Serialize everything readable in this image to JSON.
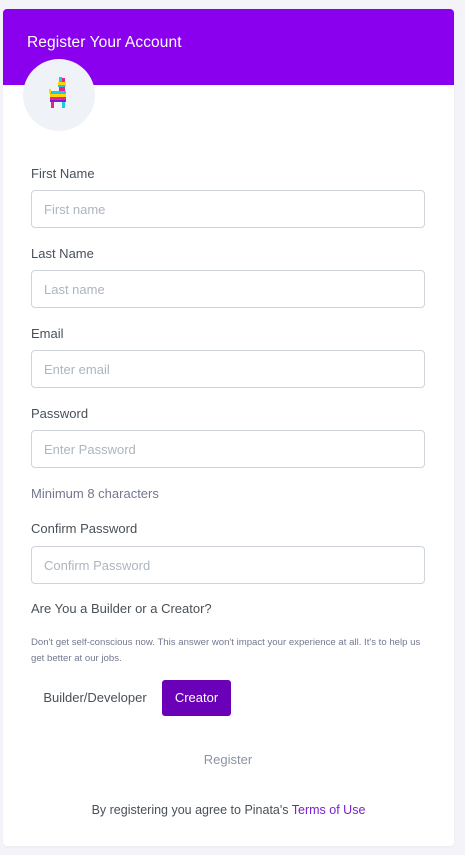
{
  "header": {
    "title": "Register Your Account"
  },
  "form": {
    "first_name": {
      "label": "First Name",
      "placeholder": "First name",
      "value": ""
    },
    "last_name": {
      "label": "Last Name",
      "placeholder": "Last name",
      "value": ""
    },
    "email": {
      "label": "Email",
      "placeholder": "Enter email",
      "value": ""
    },
    "password": {
      "label": "Password",
      "placeholder": "Enter Password",
      "value": "",
      "hint": "Minimum 8 characters"
    },
    "confirm_password": {
      "label": "Confirm Password",
      "placeholder": "Confirm Password",
      "value": ""
    },
    "role": {
      "question": "Are You a Builder or a Creator?",
      "note": "Don't get self-conscious now. This answer won't impact your experience at all. It's to help us get better at our jobs.",
      "options": [
        "Builder/Developer",
        "Creator"
      ],
      "selected": "Creator"
    },
    "register_label": "Register"
  },
  "footer": {
    "terms_prefix": "By registering you agree to Pinata's ",
    "terms_link": "Terms of Use"
  },
  "colors": {
    "header_bg": "#8a00ee",
    "selected_option_bg": "#6a00b8",
    "link": "#7a1fd1",
    "page_bg": "#f3f3f9"
  },
  "icons": {
    "logo": "pinata-logo-icon"
  }
}
